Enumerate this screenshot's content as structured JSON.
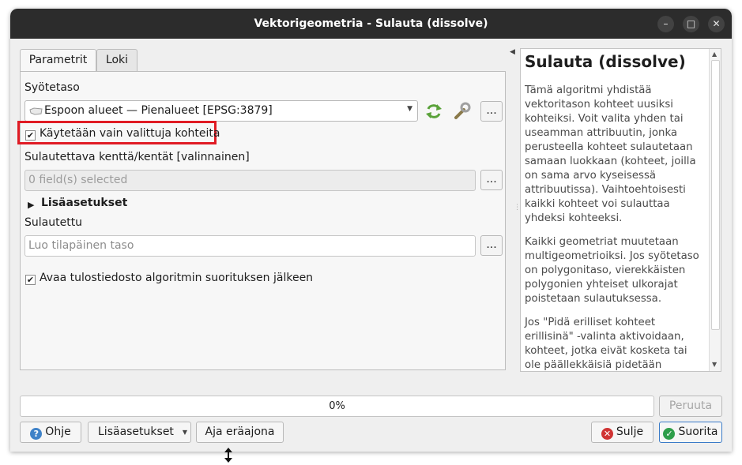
{
  "window": {
    "title": "Vektorigeometria - Sulauta (dissolve)",
    "minimize_glyph": "–",
    "maximize_glyph": "□",
    "close_glyph": "✕"
  },
  "tabs": [
    {
      "label": "Parametrit",
      "active": true
    },
    {
      "label": "Loki",
      "active": false
    }
  ],
  "params": {
    "input_label": "Syötetaso",
    "input_value": "Espoon alueet — Pienalueet [EPSG:3879]",
    "selected_only_label": "Käytetään vain valittuja kohteita",
    "selected_only_checked": true,
    "fields_label": "Sulautettava kenttä/kentät [valinnainen]",
    "fields_value": "0 field(s) selected",
    "advanced_label": "Lisäasetukset",
    "output_label": "Sulautettu",
    "output_placeholder": "Luo tilapäinen taso",
    "open_output_label": "Avaa tulostiedosto algoritmin suorituksen jälkeen",
    "open_output_checked": true,
    "dots": "..."
  },
  "help": {
    "title": "Sulauta (dissolve)",
    "paragraphs": [
      "Tämä algoritmi yhdistää vektoritason kohteet uusiksi kohteiksi. Voit valita yhden tai useamman attribuutin, jonka perusteella kohteet sulautetaan samaan luokkaan (kohteet, joilla on sama arvo kyseisessä attribuutissa). Vaihtoehtoisesti kaikki kohteet voi sulauttaa yhdeksi kohteeksi.",
      "Kaikki geometriat muutetaan multigeometrioiksi. Jos syötetaso on polygonitaso, vierekkäisten polygonien yhteiset ulkorajat poistetaan sulautuksessa.",
      "Jos \"Pidä erilliset kohteet erillisinä\" -valinta aktivoidaan, kohteet, jotka eivät kosketa tai ole päällekkäisiä pidetään erillisinä"
    ]
  },
  "progress": {
    "value": 0,
    "text": "0%"
  },
  "buttons": {
    "cancel": "Peruuta",
    "help": "Ohje",
    "advanced": "Lisäasetukset",
    "batch": "Aja eräajona",
    "close": "Sulje",
    "run": "Suorita"
  },
  "colors": {
    "titlebar": "#2c2c2c",
    "highlight": "#e01b24",
    "help_icon": "#3f82c8",
    "close_icon": "#d03434",
    "run_icon": "#2e9e4a",
    "run_border": "#3a7bc8"
  }
}
